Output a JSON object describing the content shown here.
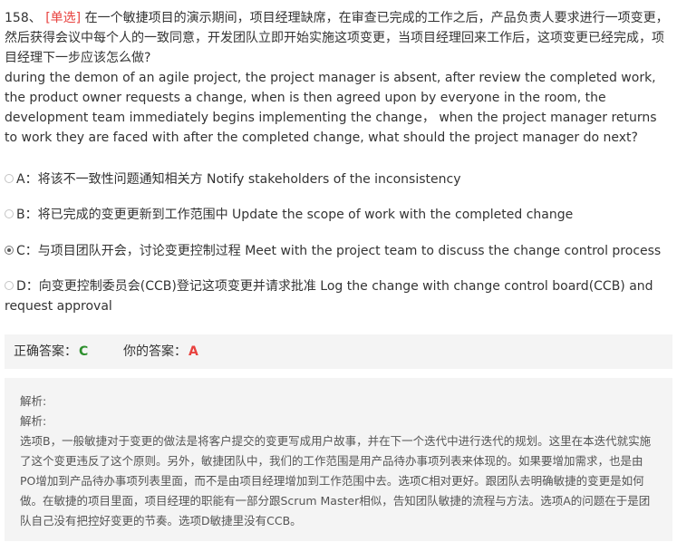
{
  "question": {
    "number": "158、",
    "type_tag": "[单选]",
    "text_cn": "在一个敏捷项目的演示期间，项目经理缺席，在审查已完成的工作之后，产品负责人要求进行一项变更，然后获得会议中每个人的一致同意，开发团队立即开始实施这项变更，当项目经理回来工作后，这项变更已经完成，项目经理下一步应该怎么做?",
    "text_en": "during the demon of an agile project, the project manager is absent, after review the completed work, the product owner requests a change, when is then agreed upon by everyone in the room, the development team immediately begins implementing the change， when the project manager returns to work they are faced with after the completed change, what should the project manager do next?"
  },
  "options": [
    {
      "letter": "A：",
      "text": "将该不一致性问题通知相关方 Notify stakeholders of the inconsistency",
      "selected": false
    },
    {
      "letter": "B：",
      "text": "将已完成的变更更新到工作范围中 Update the scope of work with the completed change",
      "selected": false
    },
    {
      "letter": "C：",
      "text": "与项目团队开会，讨论变更控制过程 Meet with the project team to discuss the change control process",
      "selected": true
    },
    {
      "letter": "D：",
      "text": "向变更控制委员会(CCB)登记这项变更并请求批准 Log the change with change control board(CCB) and request approval",
      "selected": false
    }
  ],
  "answers": {
    "correct_label": "正确答案：",
    "correct_value": "C",
    "your_label": "你的答案：",
    "your_value": "A"
  },
  "analysis": {
    "heading1": "解析:",
    "heading2": "解析:",
    "body": "选项B，一般敏捷对于变更的做法是将客户提交的变更写成用户故事，并在下一个迭代中进行迭代的规划。这里在本迭代就实施了这个变更违反了这个原则。另外，敏捷团队中，我们的工作范围是用产品待办事项列表来体现的。如果要增加需求，也是由PO增加到产品待办事项列表里面，而不是由项目经理增加到工作范围中去。选项C相对更好。跟团队去明确敏捷的变更是如何做。在敏捷的项目里面，项目经理的职能有一部分跟Scrum Master相似，告知团队敏捷的流程与方法。选项A的问题在于是团队自己没有把控好变更的节奏。选项D敏捷里没有CCB。"
  },
  "colors": {
    "type_tag": "#e8423f",
    "correct": "#2d8f2d",
    "wrong": "#e8423f",
    "panel_bg": "#f4f4f4"
  }
}
